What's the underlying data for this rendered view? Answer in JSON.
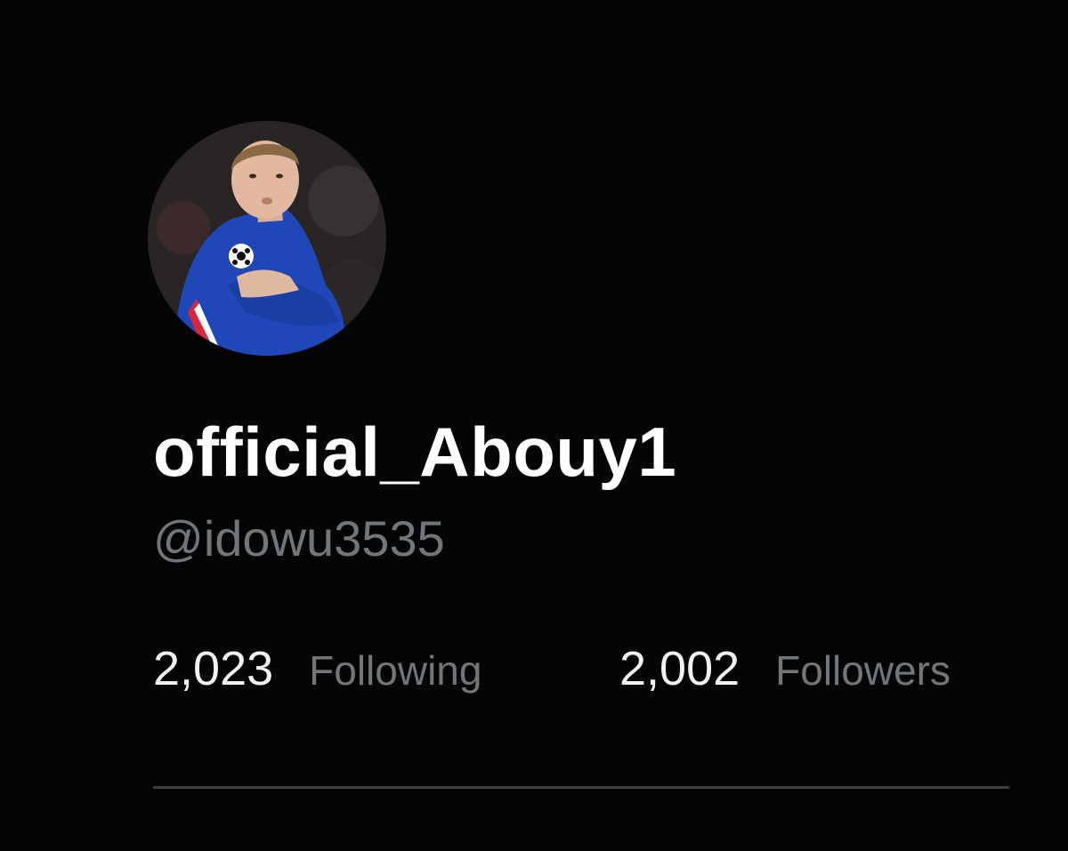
{
  "profile": {
    "avatar_icon": "profile-photo",
    "display_name": "official_Abouy1",
    "handle": "@idowu3535",
    "stats": {
      "following_count": "2,023",
      "following_label": "Following",
      "followers_count": "2,002",
      "followers_label": "Followers"
    }
  },
  "colors": {
    "background": "#050505",
    "primary_text": "#ffffff",
    "secondary_text": "#71767b",
    "divider": "#3b3f44"
  }
}
